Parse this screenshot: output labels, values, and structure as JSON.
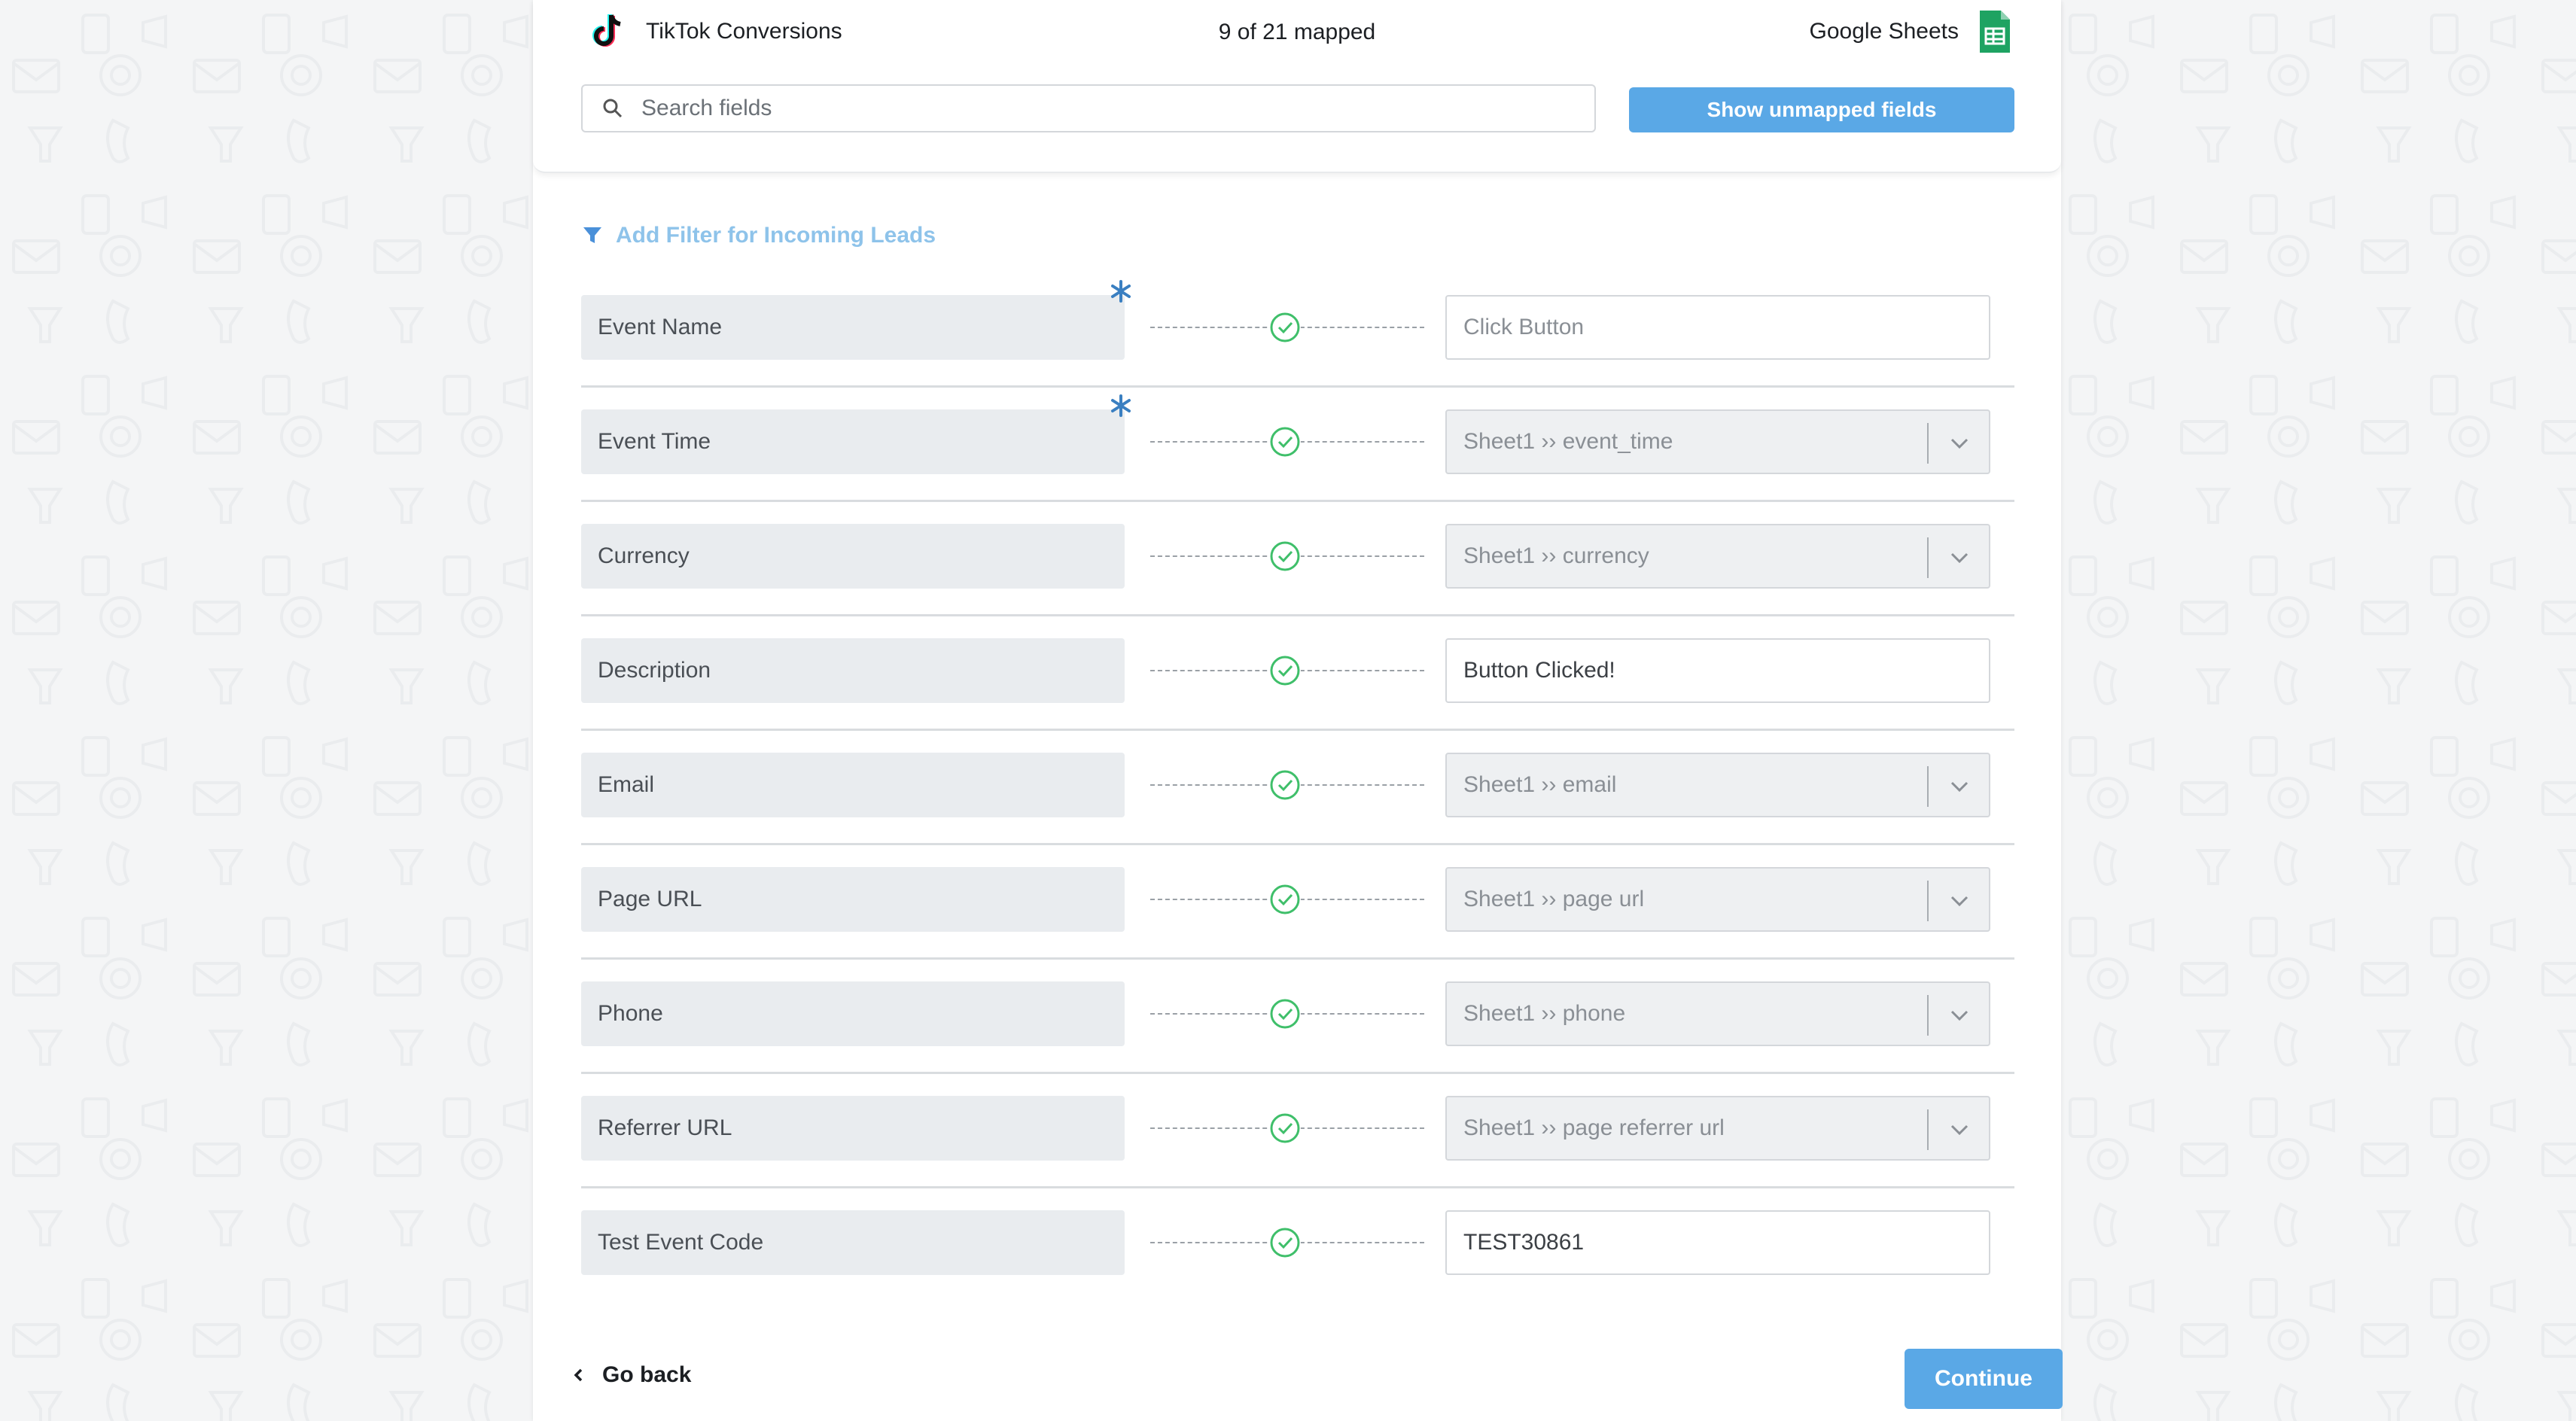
{
  "header": {
    "source_app": "TikTok Conversions",
    "mapped_count": "9 of 21 mapped",
    "destination_app": "Google Sheets",
    "source_icon": "tiktok-logo-icon",
    "destination_icon": "google-sheets-icon"
  },
  "search": {
    "placeholder": "Search fields",
    "icon": "search-icon"
  },
  "buttons": {
    "show_unmapped": "Show unmapped fields",
    "continue": "Continue",
    "go_back": "Go back"
  },
  "filter": {
    "label": "Add Filter for Incoming Leads",
    "icon": "filter-icon"
  },
  "mappings": [
    {
      "field": "Event Name",
      "required": true,
      "kind": "input",
      "value": "Click Button"
    },
    {
      "field": "Event Time",
      "required": true,
      "kind": "select",
      "value": "Sheet1 ›› event_time"
    },
    {
      "field": "Currency",
      "required": false,
      "kind": "select",
      "value": "Sheet1 ›› currency"
    },
    {
      "field": "Description",
      "required": false,
      "kind": "input-filled",
      "value": "Button Clicked!"
    },
    {
      "field": "Email",
      "required": false,
      "kind": "select",
      "value": "Sheet1 ›› email"
    },
    {
      "field": "Page URL",
      "required": false,
      "kind": "select",
      "value": "Sheet1 ›› page url"
    },
    {
      "field": "Phone",
      "required": false,
      "kind": "select",
      "value": "Sheet1 ›› phone"
    },
    {
      "field": "Referrer URL",
      "required": false,
      "kind": "select",
      "value": "Sheet1 ›› page referrer url"
    },
    {
      "field": "Test Event Code",
      "required": false,
      "kind": "input-filled",
      "value": "TEST30861"
    }
  ],
  "colors": {
    "accent": "#5aa8e6",
    "filter_text": "#8ec3ea",
    "check": "#3fbf6a",
    "required_star": "#3a7fc1"
  }
}
